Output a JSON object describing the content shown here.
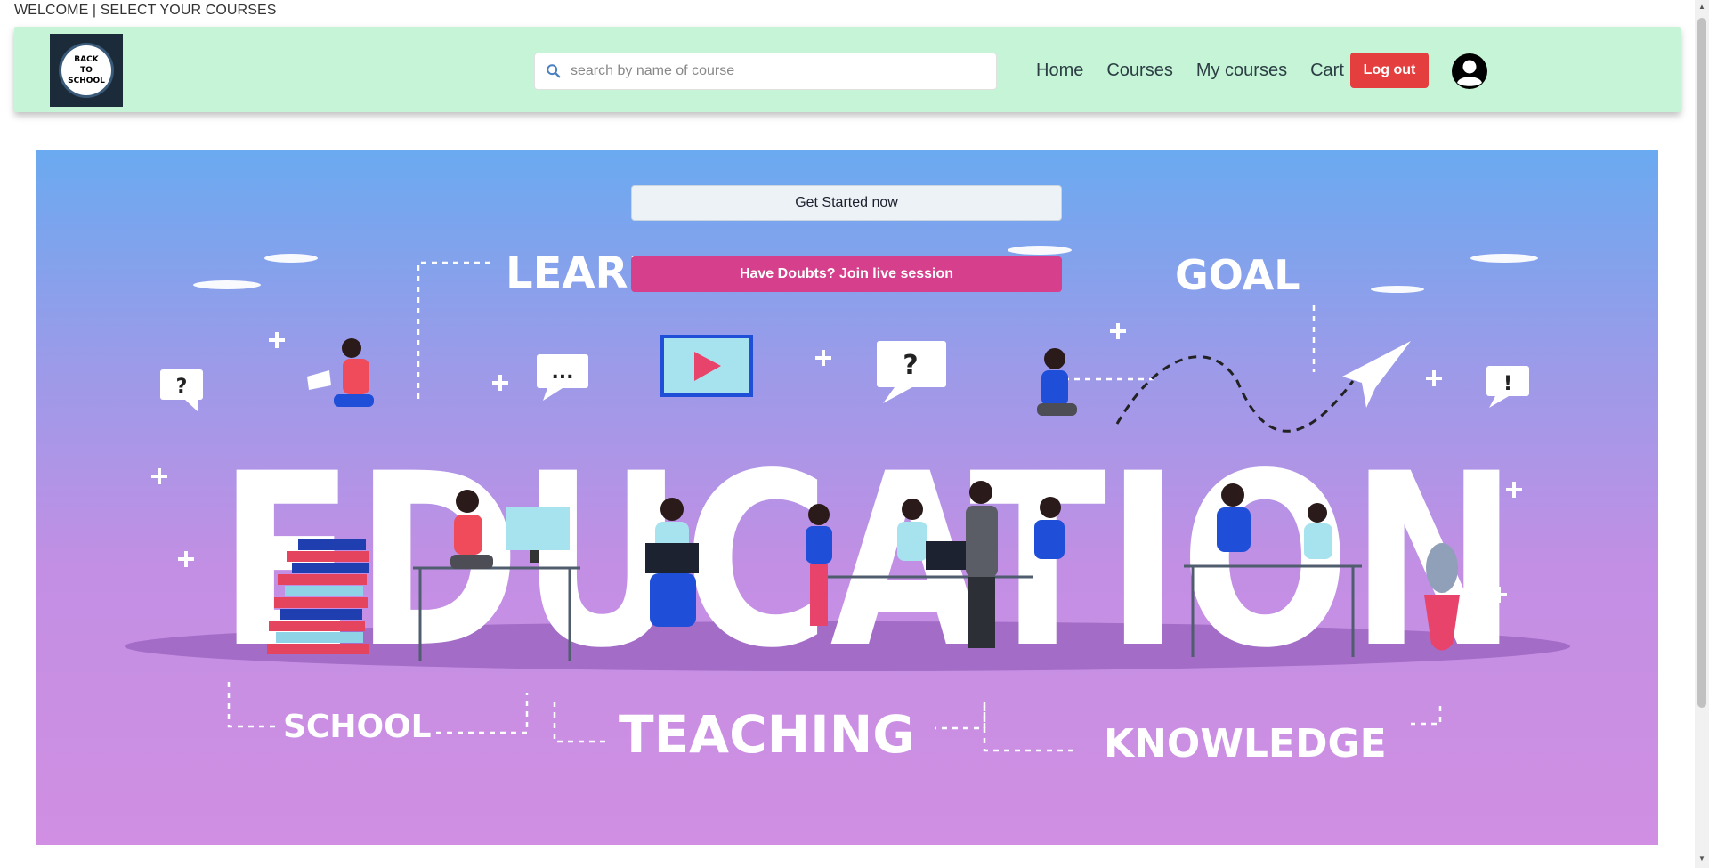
{
  "page": {
    "welcome": "WELCOME | SELECT YOUR COURSES"
  },
  "nav": {
    "logo_text": [
      "BACK",
      "TO",
      "SCHOOL"
    ],
    "search": {
      "placeholder": "search by name of course",
      "icon": "search-icon"
    },
    "links": [
      {
        "label": "Home"
      },
      {
        "label": "Courses"
      },
      {
        "label": "My courses"
      },
      {
        "label": "Cart"
      }
    ],
    "logout_label": "Log out",
    "avatar_icon": "user-icon"
  },
  "hero": {
    "get_started_label": "Get Started now",
    "doubts_label": "Have Doubts? Join live session",
    "illustration_words": {
      "main": "EDUCATION",
      "learn": "LEARN",
      "goal": "GOAL",
      "school": "SCHOOL",
      "teaching": "TEACHING",
      "knowledge": "KNOWLEDGE"
    }
  },
  "colors": {
    "navbar_bg": "#c6f4d6",
    "logout_bg": "#e53e3e",
    "doubts_bg": "#d53f8c",
    "start_bg": "#edf2f7"
  }
}
